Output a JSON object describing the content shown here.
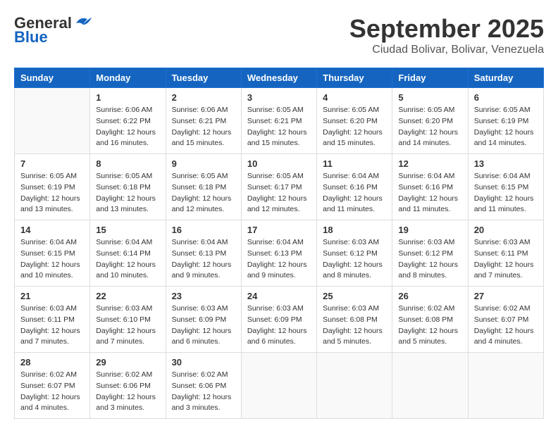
{
  "logo": {
    "general": "General",
    "blue": "Blue"
  },
  "title": "September 2025",
  "subtitle": "Ciudad Bolivar, Bolivar, Venezuela",
  "days_of_week": [
    "Sunday",
    "Monday",
    "Tuesday",
    "Wednesday",
    "Thursday",
    "Friday",
    "Saturday"
  ],
  "weeks": [
    [
      {
        "day": "",
        "info": ""
      },
      {
        "day": "1",
        "info": "Sunrise: 6:06 AM\nSunset: 6:22 PM\nDaylight: 12 hours\nand 16 minutes."
      },
      {
        "day": "2",
        "info": "Sunrise: 6:06 AM\nSunset: 6:21 PM\nDaylight: 12 hours\nand 15 minutes."
      },
      {
        "day": "3",
        "info": "Sunrise: 6:05 AM\nSunset: 6:21 PM\nDaylight: 12 hours\nand 15 minutes."
      },
      {
        "day": "4",
        "info": "Sunrise: 6:05 AM\nSunset: 6:20 PM\nDaylight: 12 hours\nand 15 minutes."
      },
      {
        "day": "5",
        "info": "Sunrise: 6:05 AM\nSunset: 6:20 PM\nDaylight: 12 hours\nand 14 minutes."
      },
      {
        "day": "6",
        "info": "Sunrise: 6:05 AM\nSunset: 6:19 PM\nDaylight: 12 hours\nand 14 minutes."
      }
    ],
    [
      {
        "day": "7",
        "info": "Sunrise: 6:05 AM\nSunset: 6:19 PM\nDaylight: 12 hours\nand 13 minutes."
      },
      {
        "day": "8",
        "info": "Sunrise: 6:05 AM\nSunset: 6:18 PM\nDaylight: 12 hours\nand 13 minutes."
      },
      {
        "day": "9",
        "info": "Sunrise: 6:05 AM\nSunset: 6:18 PM\nDaylight: 12 hours\nand 12 minutes."
      },
      {
        "day": "10",
        "info": "Sunrise: 6:05 AM\nSunset: 6:17 PM\nDaylight: 12 hours\nand 12 minutes."
      },
      {
        "day": "11",
        "info": "Sunrise: 6:04 AM\nSunset: 6:16 PM\nDaylight: 12 hours\nand 11 minutes."
      },
      {
        "day": "12",
        "info": "Sunrise: 6:04 AM\nSunset: 6:16 PM\nDaylight: 12 hours\nand 11 minutes."
      },
      {
        "day": "13",
        "info": "Sunrise: 6:04 AM\nSunset: 6:15 PM\nDaylight: 12 hours\nand 11 minutes."
      }
    ],
    [
      {
        "day": "14",
        "info": "Sunrise: 6:04 AM\nSunset: 6:15 PM\nDaylight: 12 hours\nand 10 minutes."
      },
      {
        "day": "15",
        "info": "Sunrise: 6:04 AM\nSunset: 6:14 PM\nDaylight: 12 hours\nand 10 minutes."
      },
      {
        "day": "16",
        "info": "Sunrise: 6:04 AM\nSunset: 6:13 PM\nDaylight: 12 hours\nand 9 minutes."
      },
      {
        "day": "17",
        "info": "Sunrise: 6:04 AM\nSunset: 6:13 PM\nDaylight: 12 hours\nand 9 minutes."
      },
      {
        "day": "18",
        "info": "Sunrise: 6:03 AM\nSunset: 6:12 PM\nDaylight: 12 hours\nand 8 minutes."
      },
      {
        "day": "19",
        "info": "Sunrise: 6:03 AM\nSunset: 6:12 PM\nDaylight: 12 hours\nand 8 minutes."
      },
      {
        "day": "20",
        "info": "Sunrise: 6:03 AM\nSunset: 6:11 PM\nDaylight: 12 hours\nand 7 minutes."
      }
    ],
    [
      {
        "day": "21",
        "info": "Sunrise: 6:03 AM\nSunset: 6:11 PM\nDaylight: 12 hours\nand 7 minutes."
      },
      {
        "day": "22",
        "info": "Sunrise: 6:03 AM\nSunset: 6:10 PM\nDaylight: 12 hours\nand 7 minutes."
      },
      {
        "day": "23",
        "info": "Sunrise: 6:03 AM\nSunset: 6:09 PM\nDaylight: 12 hours\nand 6 minutes."
      },
      {
        "day": "24",
        "info": "Sunrise: 6:03 AM\nSunset: 6:09 PM\nDaylight: 12 hours\nand 6 minutes."
      },
      {
        "day": "25",
        "info": "Sunrise: 6:03 AM\nSunset: 6:08 PM\nDaylight: 12 hours\nand 5 minutes."
      },
      {
        "day": "26",
        "info": "Sunrise: 6:02 AM\nSunset: 6:08 PM\nDaylight: 12 hours\nand 5 minutes."
      },
      {
        "day": "27",
        "info": "Sunrise: 6:02 AM\nSunset: 6:07 PM\nDaylight: 12 hours\nand 4 minutes."
      }
    ],
    [
      {
        "day": "28",
        "info": "Sunrise: 6:02 AM\nSunset: 6:07 PM\nDaylight: 12 hours\nand 4 minutes."
      },
      {
        "day": "29",
        "info": "Sunrise: 6:02 AM\nSunset: 6:06 PM\nDaylight: 12 hours\nand 3 minutes."
      },
      {
        "day": "30",
        "info": "Sunrise: 6:02 AM\nSunset: 6:06 PM\nDaylight: 12 hours\nand 3 minutes."
      },
      {
        "day": "",
        "info": ""
      },
      {
        "day": "",
        "info": ""
      },
      {
        "day": "",
        "info": ""
      },
      {
        "day": "",
        "info": ""
      }
    ]
  ]
}
